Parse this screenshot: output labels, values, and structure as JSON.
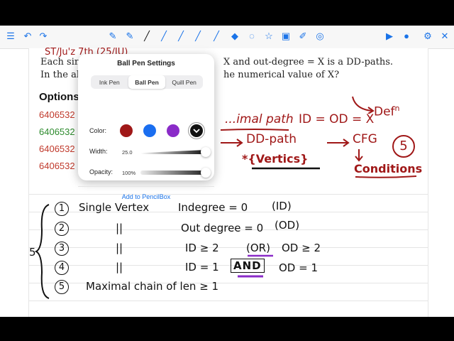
{
  "toolbar": {
    "icons": [
      "list-icon",
      "undo-icon",
      "redo-icon",
      "pen-tool-icon",
      "pen-tool-icon",
      "pen-black-icon",
      "pen-blue-icon",
      "pen-blue-icon",
      "pen-blue-icon",
      "highlighter-icon",
      "eraser-icon",
      "lasso-icon",
      "shapes-icon",
      "image-icon",
      "eyedropper-icon",
      "target-icon",
      "play-icon",
      "mic-icon",
      "settings-icon",
      "close-icon"
    ]
  },
  "document": {
    "header_scribble": "ST/Ju'z 7th (25/JU)",
    "line1_a": "Each sin",
    "line1_b": "X and out-degree = X is a DD-paths.",
    "line2_a": "In the al",
    "line2_b": "he numerical value of X?",
    "options_title": "Options",
    "options": [
      {
        "text": "6406532",
        "color": "#c0392b"
      },
      {
        "text": "6406532",
        "color": "#2e8b2e"
      },
      {
        "text": "6406532",
        "color": "#c0392b"
      },
      {
        "text": "6406532",
        "color": "#c0392b"
      }
    ]
  },
  "annotations": {
    "maximal_path": "...imal path",
    "id_od": "ID = OD = X",
    "def": "Def",
    "def_sup": "n",
    "dd_path": "DD-path",
    "cfg": "CFG",
    "five": "5",
    "vertices": "*{Vertics}",
    "conditions": "Conditions",
    "rows": [
      {
        "n": "1",
        "left": "Single Vertex",
        "right": "Indegree = 0",
        "tag": "(ID)"
      },
      {
        "n": "2",
        "left": "||",
        "right": "Out degree = 0",
        "tag": "(OD)"
      },
      {
        "n": "3",
        "left": "||",
        "right": "ID ≥ 2",
        "tag": "(OR)",
        "extra": "OD ≥ 2"
      },
      {
        "n": "4",
        "left": "||",
        "right": "ID = 1",
        "tag": "AND",
        "extra": "OD = 1"
      },
      {
        "n": "5",
        "left": "Maximal chain of len ≥ 1"
      }
    ],
    "brace_count": "5"
  },
  "popup": {
    "title": "Ball Pen Settings",
    "tabs": [
      {
        "label": "Ink Pen",
        "selected": false
      },
      {
        "label": "Ball Pen",
        "selected": true
      },
      {
        "label": "Quill Pen",
        "selected": false
      }
    ],
    "color_label": "Color:",
    "colors": [
      "#a01818",
      "#1a6ef0",
      "#8a2bc8",
      "#111111"
    ],
    "selected_color_index": 3,
    "width_label": "Width:",
    "width_value": "25.0",
    "width_level": 1.0,
    "opacity_label": "Opacity:",
    "opacity_value": "100%",
    "opacity_level": 1.0,
    "add_link": "Add to PencilBox"
  }
}
